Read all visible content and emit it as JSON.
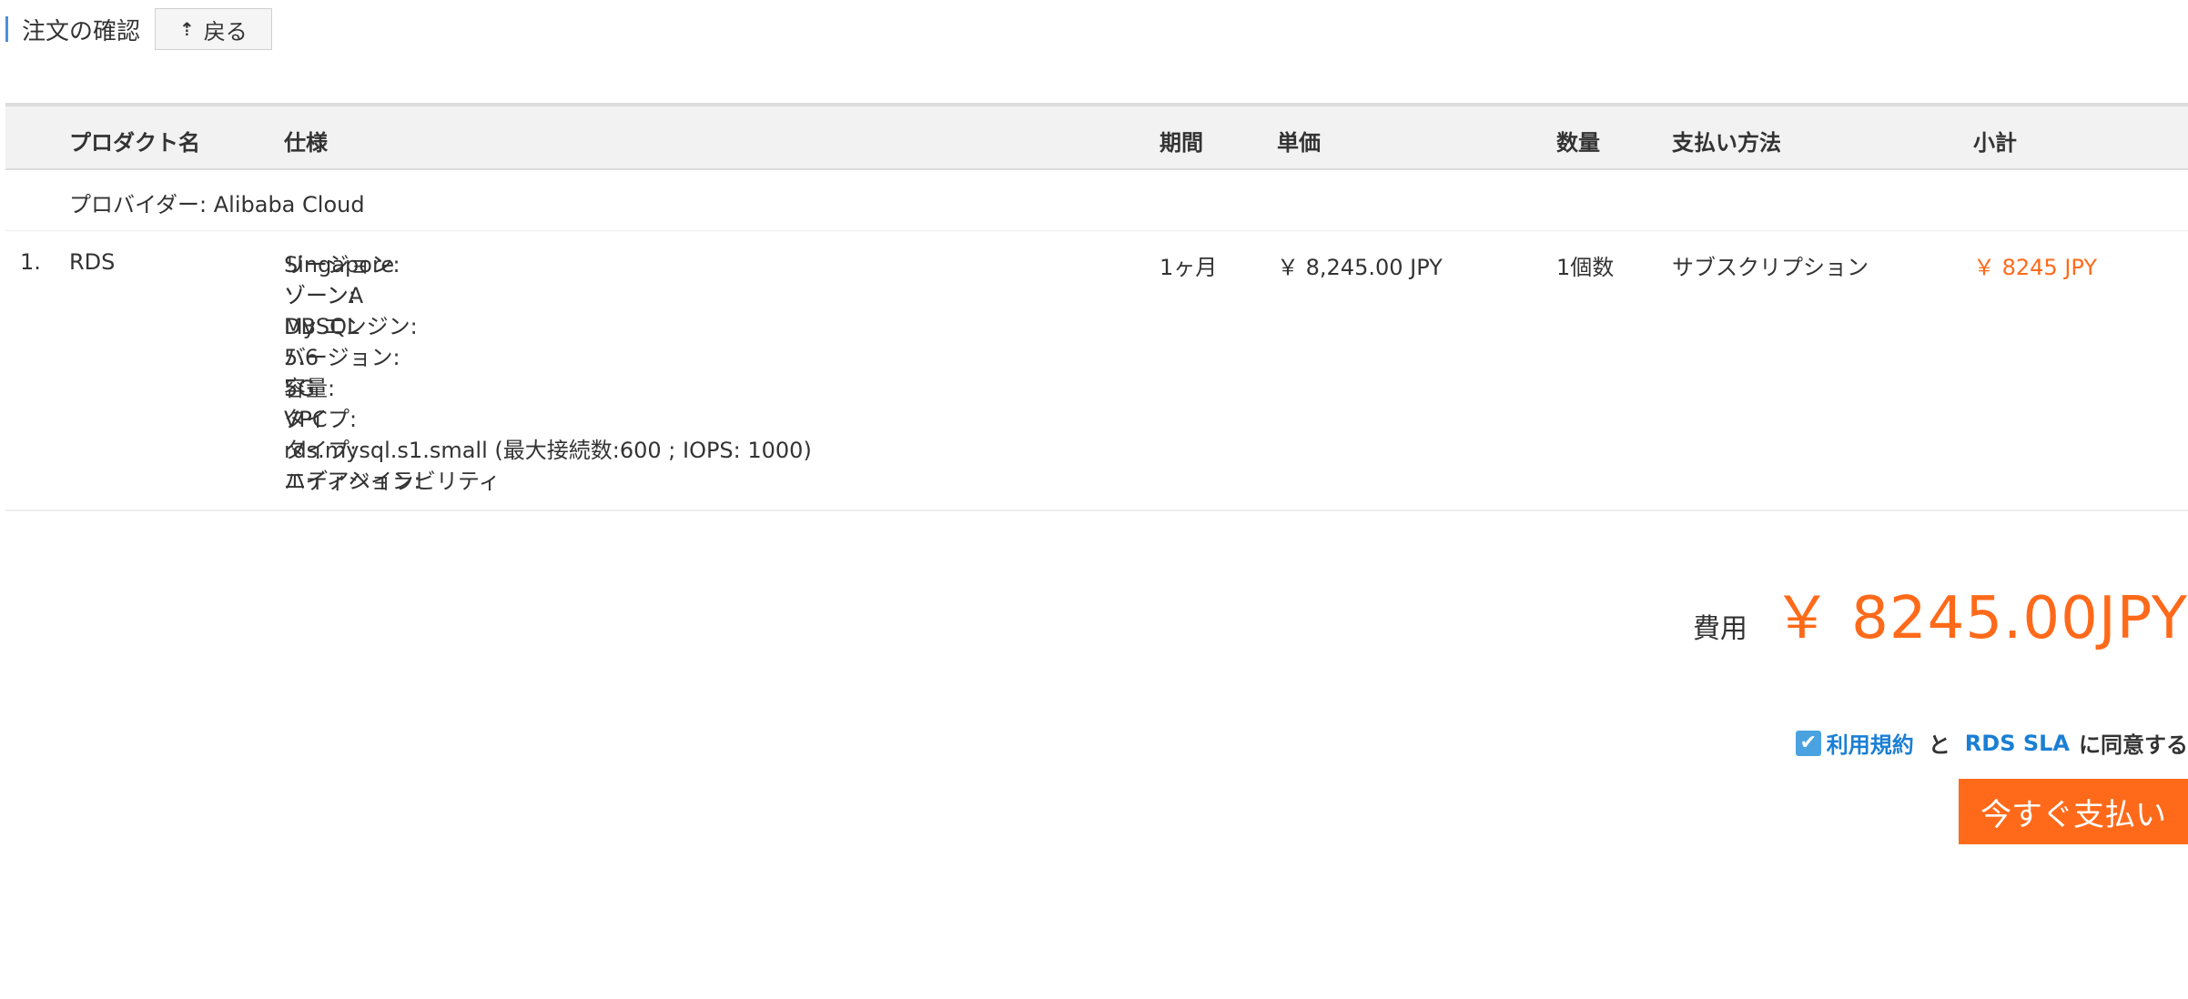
{
  "header": {
    "title": "注文の確認",
    "back_label": "戻る"
  },
  "table": {
    "columns": {
      "product": "プロダクト名",
      "spec": "仕様",
      "period": "期間",
      "unit_price": "単価",
      "quantity": "数量",
      "payment": "支払い方法",
      "subtotal": "小計"
    },
    "provider": "プロバイダー: Alibaba Cloud",
    "rows": [
      {
        "index": "1.",
        "product": "RDS",
        "specs": [
          {
            "label": "リージョン:",
            "value": "Singapore"
          },
          {
            "label": "ゾーン:",
            "value": "ゾーンA"
          },
          {
            "label": "DB エンジン:",
            "value": "MySQL"
          },
          {
            "label": "バージョン:",
            "value": "5.6"
          },
          {
            "label": "容量:",
            "value": "5G"
          },
          {
            "label": "タイプ:",
            "value": "VPC"
          },
          {
            "label": "タイプ:",
            "value": "rds.mysql.s1.small (最大接続数:600 ; IOPS: 1000)"
          },
          {
            "label": "エディション:",
            "value": "ハイアベイラビリティ"
          }
        ],
        "period": "1ヶ月",
        "unit_price": "￥ 8,245.00 JPY",
        "quantity": "1個数",
        "payment": "サブスクリプション",
        "subtotal": "￥ 8245 JPY"
      }
    ]
  },
  "total": {
    "label": "費用",
    "amount": "￥ 8245.00JPY"
  },
  "agreement": {
    "checked": true,
    "terms_link": "利用規約",
    "and": "と",
    "sla_link": "RDS SLA",
    "suffix": "に同意する"
  },
  "pay_button_label": "今すぐ支払い",
  "colors": {
    "accent": "#ff6a1a",
    "link": "#1a7fd4",
    "checkbox": "#4aa3e0"
  }
}
